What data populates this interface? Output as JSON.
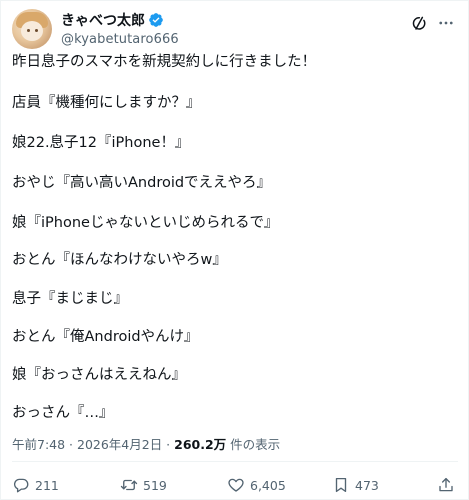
{
  "user": {
    "display_name": "きゃべつ太郎",
    "handle": "@kyabetutaro666"
  },
  "icons": {
    "verified": "verified-badge-icon",
    "grok": "grok-icon",
    "more": "more-icon",
    "reply": "reply-icon",
    "retweet": "retweet-icon",
    "like": "heart-icon",
    "bookmark": "bookmark-icon",
    "share": "share-icon"
  },
  "colors": {
    "text": "#0f1419",
    "secondary": "#536471",
    "verified": "#1d9bf0"
  },
  "tweet": {
    "lines": [
      "昨日息子のスマホを新規契約しに行きました！",
      "店員『機種何にしますか？』",
      "娘22.息子12『iPhone！』",
      "おやじ『高い高いAndroidでええやろ』",
      "娘『iPhoneじゃないといじめられるで』",
      "おとん『ほんなわけないやろw』",
      "息子『まじまじ』",
      "おとん『俺Androidやんけ』",
      "娘『おっさんはええねん』",
      "おっさん『…』"
    ]
  },
  "meta": {
    "time_date": "午前7:48 · 2026年4月2日 · ",
    "views": "260.2万",
    "views_suffix": " 件の表示"
  },
  "actions": {
    "replies": "211",
    "retweets": "519",
    "likes": "6,405",
    "bookmarks": "473"
  }
}
